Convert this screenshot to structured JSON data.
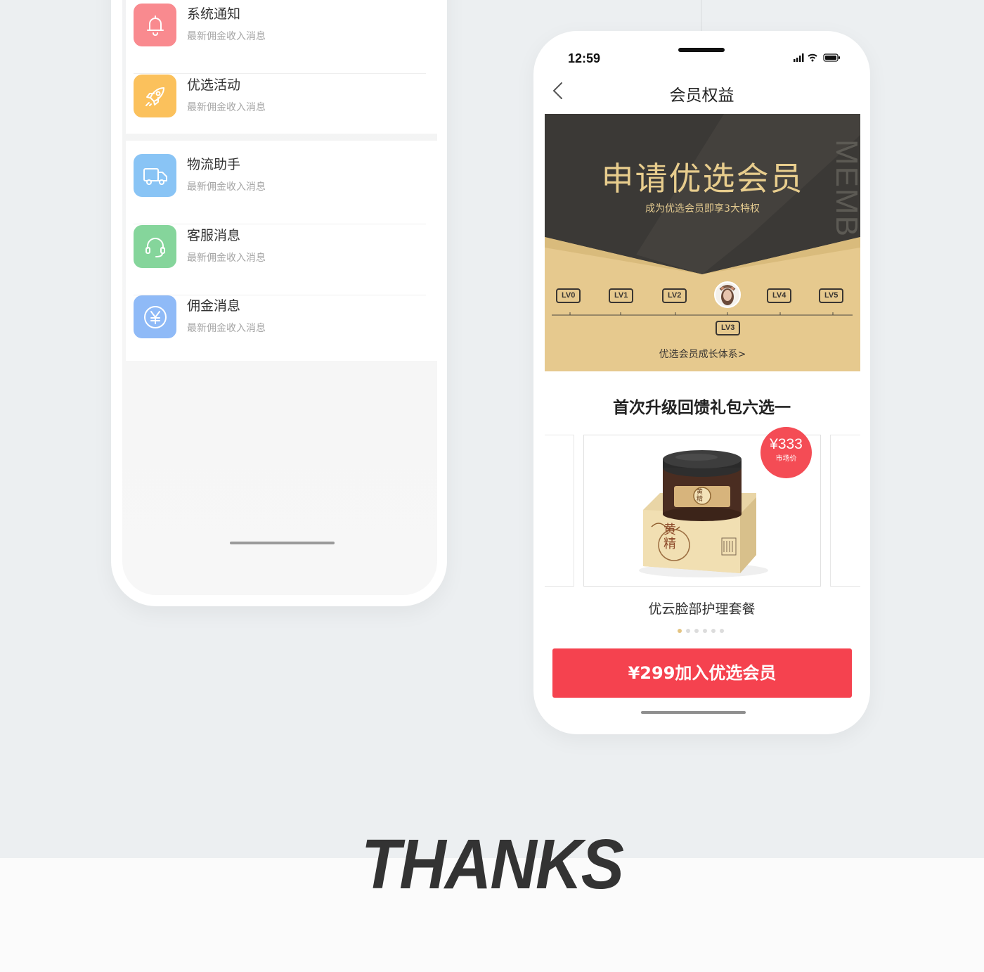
{
  "messages": [
    {
      "title": "系统通知",
      "sub": "最新佣金收入消息",
      "icon": "bell-icon",
      "color": "#f98a8f"
    },
    {
      "title": "优选活动",
      "sub": "最新佣金收入消息",
      "icon": "rocket-icon",
      "color": "#fbc15c"
    },
    {
      "title": "物流助手",
      "sub": "最新佣金收入消息",
      "icon": "truck-icon",
      "color": "#89c4f5"
    },
    {
      "title": "客服消息",
      "sub": "最新佣金收入消息",
      "icon": "headset-icon",
      "color": "#85d59b"
    },
    {
      "title": "佣金消息",
      "sub": "最新佣金收入消息",
      "icon": "yuan-icon",
      "color": "#8fbaf7"
    }
  ],
  "status": {
    "time": "12:59"
  },
  "nav": {
    "title": "会员权益"
  },
  "banner": {
    "title": "申请优选会员",
    "subtitle": "成为优选会员即享3大特权",
    "side_text": "MEMB",
    "levels": [
      "LV0",
      "LV1",
      "LV2",
      "LV3",
      "LV4",
      "LV5"
    ],
    "current_level": "LV3",
    "link": "优选会员成长体系>"
  },
  "gift": {
    "title": "首次升级回馈礼包六选一",
    "price": "¥333",
    "price_label": "市场价",
    "product_name": "优云脸部护理套餐",
    "jar_label": "黄精",
    "box_text": "黄精"
  },
  "dots": {
    "count": 6,
    "active": 0
  },
  "cta": {
    "label": "¥299加入优选会员"
  },
  "footer": {
    "thanks": "THANKS"
  }
}
